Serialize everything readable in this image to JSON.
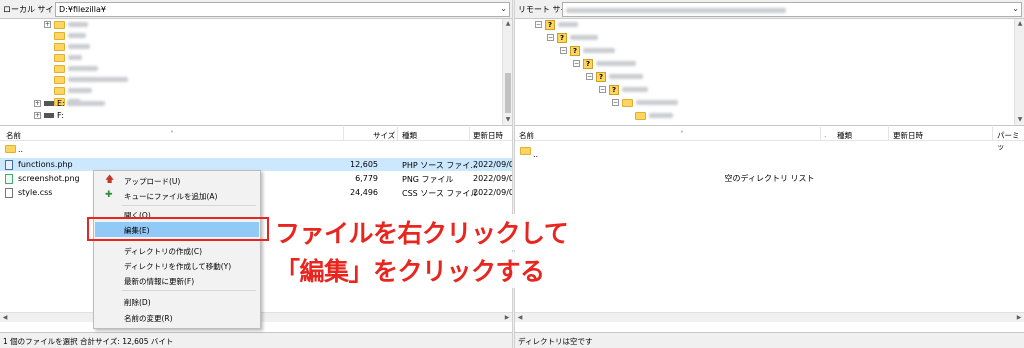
{
  "local": {
    "site_label": "ローカル サイト:",
    "site_path": "D:¥filezilla¥",
    "drives": [
      "E:",
      "F:"
    ],
    "columns": {
      "name": "名前",
      "size": "サイズ",
      "type": "種類",
      "modified": "更新日時"
    },
    "parent_row": "..",
    "files": [
      {
        "name": "functions.php",
        "size": "12,605",
        "type": "PHP ソース ファイ...",
        "date": "2022/09/0",
        "icon": "php-file-icon",
        "selected": true
      },
      {
        "name": "screenshot.png",
        "size": "6,779",
        "type": "PNG ファイル",
        "date": "2022/09/0",
        "icon": "png-file-icon",
        "selected": false
      },
      {
        "name": "style.css",
        "size": "24,496",
        "type": "CSS ソース ファイル",
        "date": "2022/09/0",
        "icon": "css-file-icon",
        "selected": false
      }
    ],
    "status": "1 個のファイルを選択 合計サイズ: 12,605 バイト"
  },
  "remote": {
    "site_label": "リモート サイト:",
    "columns": {
      "name": "名前",
      "type": "種類",
      "modified": "更新日時",
      "permissions": "パーミッ"
    },
    "parent_row": "..",
    "empty_message": "空のディレクトリ リスト",
    "status": "ディレクトリは空です"
  },
  "context_menu": {
    "items": [
      {
        "label": "アップロード(U)",
        "icon": "upload-arrow-icon",
        "highlighted": false
      },
      {
        "label": "キューにファイルを追加(A)",
        "icon": "add-to-queue-icon",
        "highlighted": false
      },
      {
        "label": "開く(O)",
        "icon": "",
        "highlighted": false
      },
      {
        "label": "編集(E)",
        "icon": "",
        "highlighted": true
      },
      {
        "label": "ディレクトリの作成(C)",
        "icon": "",
        "highlighted": false
      },
      {
        "label": "ディレクトリを作成して移動(Y)",
        "icon": "",
        "highlighted": false
      },
      {
        "label": "最新の情報に更新(F)",
        "icon": "",
        "highlighted": false
      },
      {
        "label": "削除(D)",
        "icon": "",
        "highlighted": false
      },
      {
        "label": "名前の変更(R)",
        "icon": "",
        "highlighted": false
      }
    ]
  },
  "annotation": {
    "line1": "ファイルを右クリックして",
    "line2": "「編集」をクリックする",
    "color": "#e8251e"
  },
  "colors": {
    "selection": "#cce8ff",
    "menu_highlight": "#91c9f7",
    "folder": "#ffd561"
  }
}
